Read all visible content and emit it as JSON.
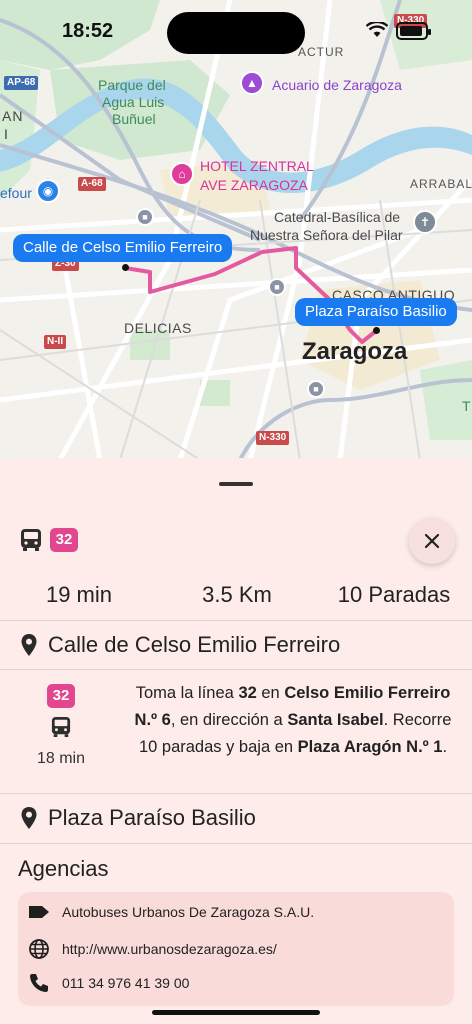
{
  "status_bar": {
    "time": "18:52"
  },
  "map": {
    "parks": [
      "Parque del",
      "Agua Luis",
      "Buñuel"
    ],
    "poi_aquarium": "Acuario de Zaragoza",
    "poi_hotel_line1": "HOTEL ZENTRAL",
    "poi_hotel_line2": "AVE ZARAGOZA",
    "poi_cathedral_line1": "Catedral-Basílica de",
    "poi_cathedral_line2": "Nuestra Señora del Pilar",
    "district_delicias": "DELICIAS",
    "district_casco": "CASCO ANTIGUO",
    "district_actur": "ACTUR",
    "district_arrabal": "ARRABAL",
    "city": "Zaragoza",
    "left_fragment_1": "AN",
    "left_fragment_2": "I",
    "left_fragment_3": "efour",
    "right_fragment": "T",
    "shields": {
      "n330_top": "N-330",
      "ap68": "AP-68",
      "a68": "A-68",
      "z30": "Z-30",
      "n2": "N-II",
      "n330_bottom": "N-330"
    },
    "origin_bubble": "Calle de Celso Emilio Ferreiro",
    "destination_bubble": "Plaza Paraíso Basilio",
    "route_color": "#e35a9f"
  },
  "sheet": {
    "line_number": "32",
    "close_icon": "close-icon",
    "stats": {
      "duration": "19 min",
      "distance": "3.5 Km",
      "stops": "10 Paradas"
    },
    "origin": "Calle de Celso Emilio Ferreiro",
    "step": {
      "line_number": "32",
      "duration": "18 min",
      "t1": "Toma la línea ",
      "b1": "32",
      "t2": " en ",
      "b2": "Celso Emilio Ferreiro N.º 6",
      "t3": ", en dirección a ",
      "b3": "Santa Isabel",
      "t4": ". Recorre 10 paradas y baja en ",
      "b4": "Plaza Aragón N.º 1",
      "t5": "."
    },
    "destination": "Plaza Paraíso Basilio",
    "agencies_title": "Agencias",
    "agency": {
      "name": "Autobuses Urbanos De Zaragoza S.A.U.",
      "url": "http://www.urbanosdezaragoza.es/",
      "phone": "011 34 976 41 39 00"
    },
    "badge_color": "#e2468e"
  }
}
